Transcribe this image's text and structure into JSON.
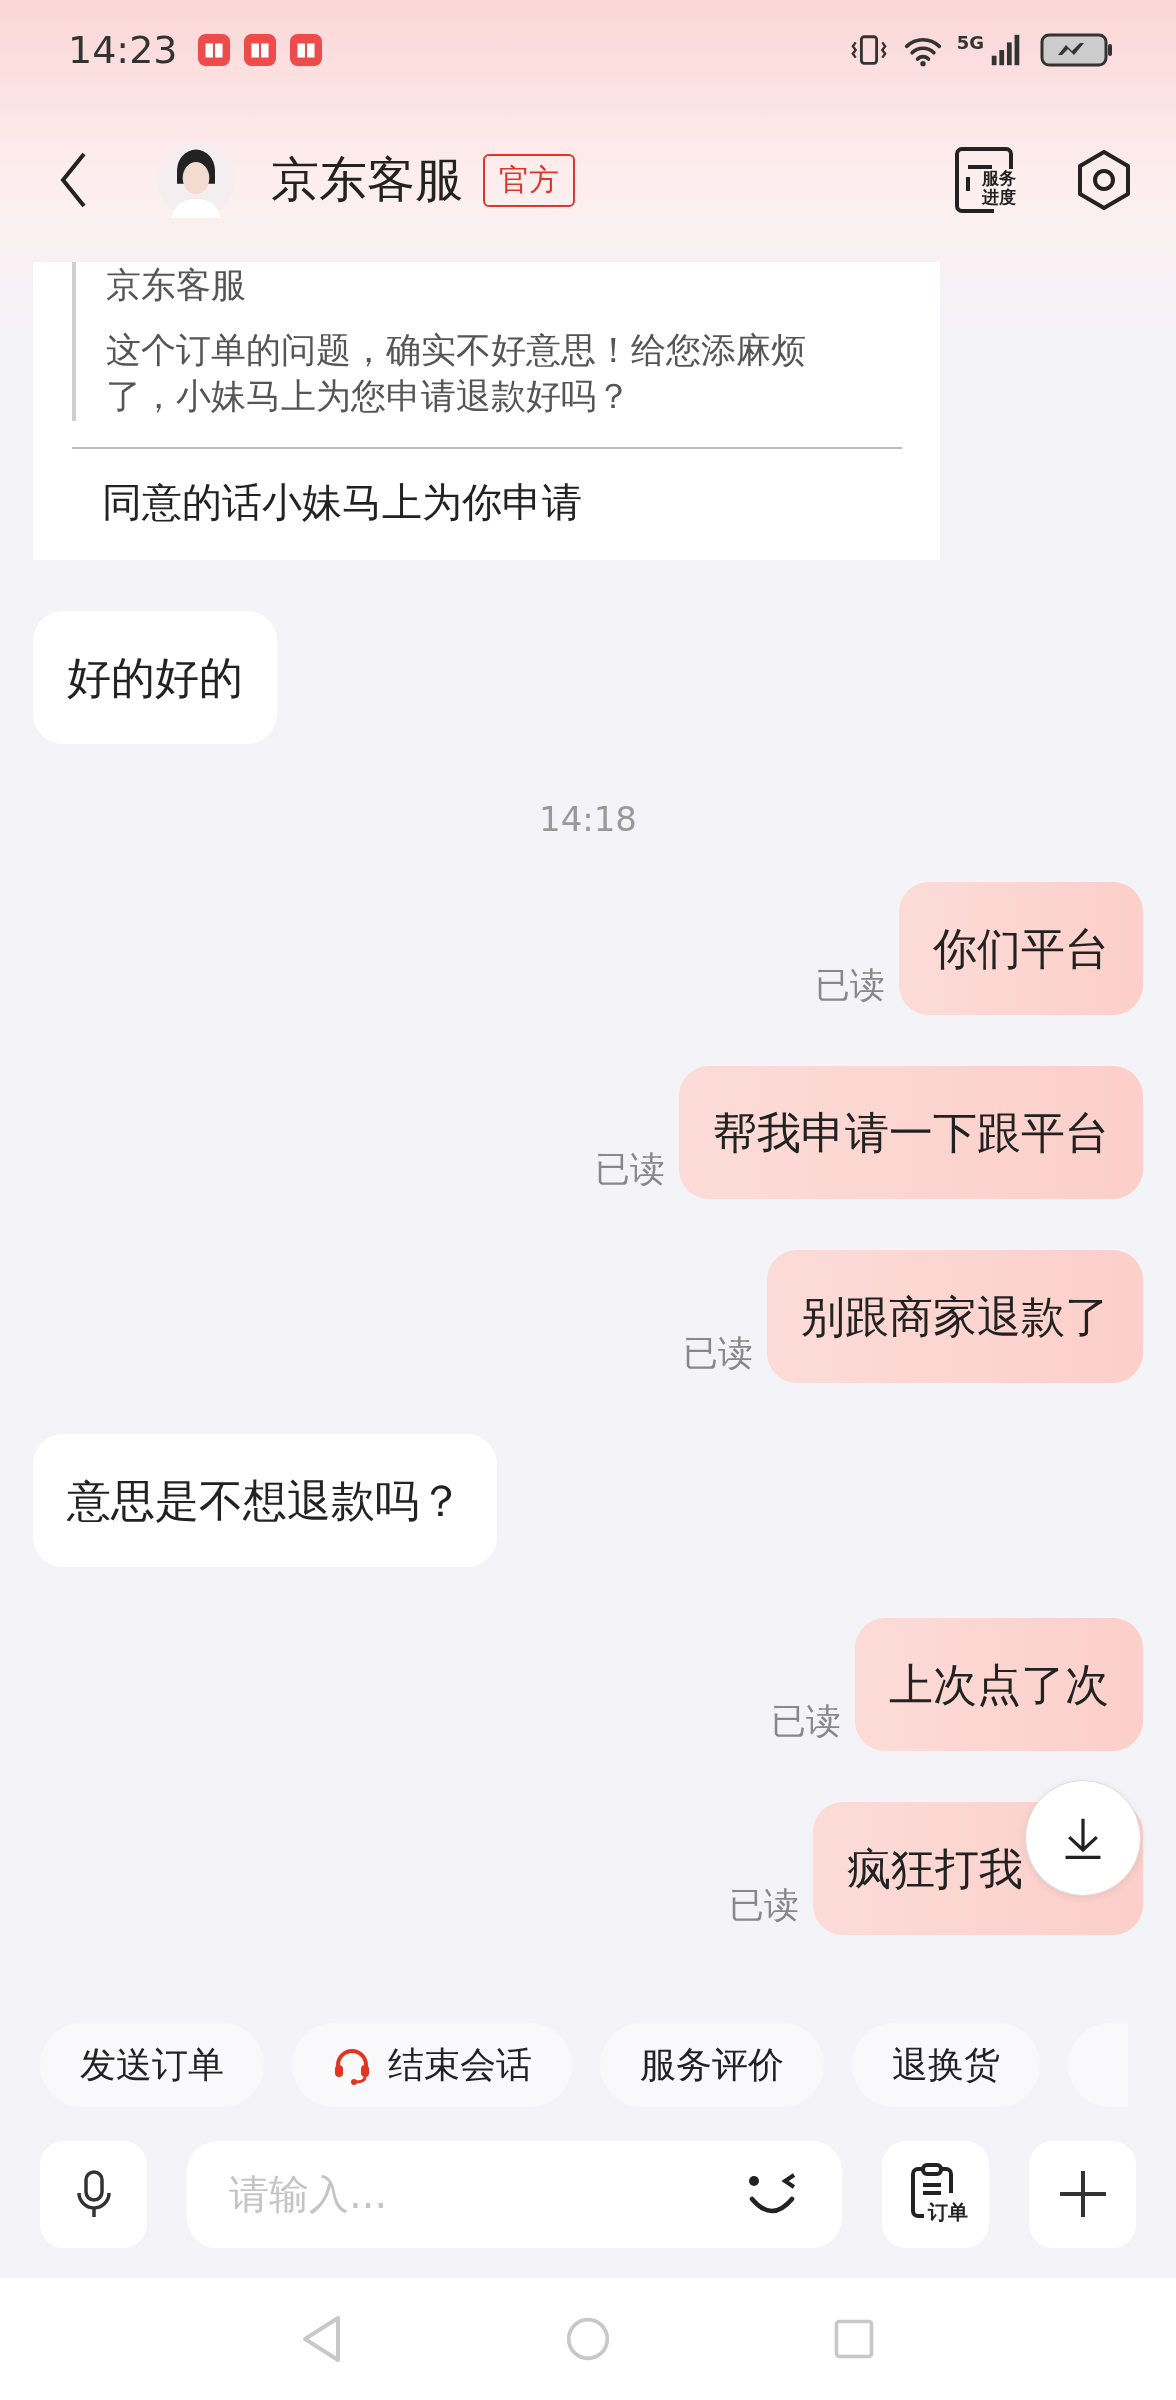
{
  "status_bar": {
    "time": "14:23",
    "network": "5G"
  },
  "header": {
    "title": "京东客服",
    "badge": "官方",
    "service_label": [
      "服务",
      "进度"
    ]
  },
  "quote_card": {
    "author": "京东客服",
    "quoted_text": "这个订单的问题，确实不好意思！给您添麻烦了，小妹马上为您申请退款好吗？",
    "reply": "同意的话小妹马上为你申请"
  },
  "messages": [
    {
      "kind": "incoming",
      "text": "好的好的"
    },
    {
      "kind": "time",
      "text": "14:18"
    },
    {
      "kind": "outgoing",
      "text": "你们平台",
      "status": "已读"
    },
    {
      "kind": "outgoing",
      "text": "帮我申请一下跟平台",
      "status": "已读"
    },
    {
      "kind": "outgoing",
      "text": "别跟商家退款了",
      "status": "已读"
    },
    {
      "kind": "incoming",
      "text": "意思是不想退款吗？"
    },
    {
      "kind": "outgoing",
      "text": "上次点了次",
      "status": "已读"
    },
    {
      "kind": "outgoing",
      "text": "疯狂打我",
      "status": "已读",
      "covered": true
    }
  ],
  "quick_actions": [
    {
      "kind": "plain",
      "label": "发送订单"
    },
    {
      "kind": "headset",
      "label": "结束会话"
    },
    {
      "kind": "plain",
      "label": "服务评价"
    },
    {
      "kind": "plain",
      "label": "退换货"
    }
  ],
  "input": {
    "placeholder": "请输入..."
  },
  "order_button": {
    "label": "订单"
  }
}
